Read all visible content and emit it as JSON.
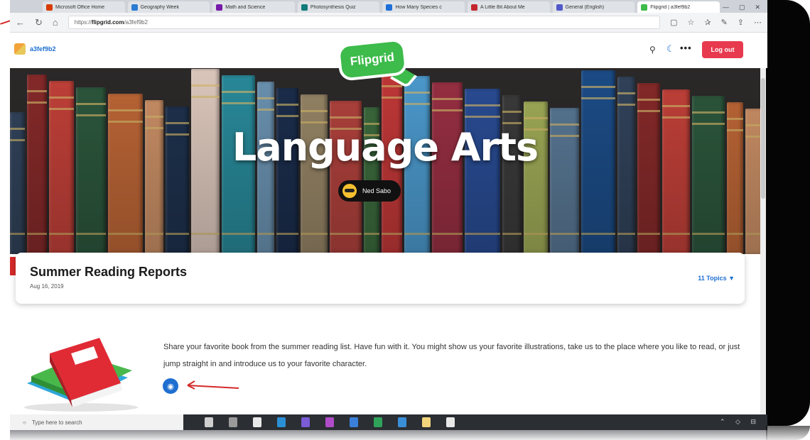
{
  "browser": {
    "tabs": [
      {
        "label": "Microsoft Office Home",
        "icon": "office-icon",
        "color": "#d83b01"
      },
      {
        "label": "Geography Week",
        "icon": "doc-icon",
        "color": "#2b7cd3"
      },
      {
        "label": "Math and Science",
        "icon": "onenote-icon",
        "color": "#7719aa"
      },
      {
        "label": "Photosynthesis Quiz",
        "icon": "forms-icon",
        "color": "#0f7b7b"
      },
      {
        "label": "How Many Species c",
        "icon": "edge-icon",
        "color": "#1e6fd9"
      },
      {
        "label": "A Little Bit About Me",
        "icon": "video-icon",
        "color": "#c4262e"
      },
      {
        "label": "General (English)",
        "icon": "teams-icon",
        "color": "#5059c9"
      },
      {
        "label": "Flipgrid | a3fef9b2",
        "icon": "flipgrid-icon",
        "color": "#3dbb4b",
        "active": true
      }
    ],
    "url_prefix": "https://",
    "url_domain": "flipgrid.com",
    "url_path": "/a3fef9b2"
  },
  "site": {
    "grid_code": "a3fef9b2",
    "logout_label": "Log out",
    "brand": "Flipgrid"
  },
  "banner": {
    "title": "Language Arts",
    "owner": "Ned Sabo"
  },
  "topic": {
    "title": "Summer Reading Reports",
    "date": "Aug 16, 2019",
    "topics_count": "11 Topics ▼",
    "prompt": "Share your favorite book from the summer reading list. Have fun with it. You might show us your favorite illustrations, take us to the place where you like to read, or just jump straight in and introduce us to your favorite character."
  },
  "taskbar": {
    "search_placeholder": "Type here to search"
  },
  "colors": {
    "accent_blue": "#1f6fd1",
    "logout_red": "#e83a4f",
    "flipgrid_green": "#3dbb4b",
    "annotation_red": "#d42a2a"
  }
}
